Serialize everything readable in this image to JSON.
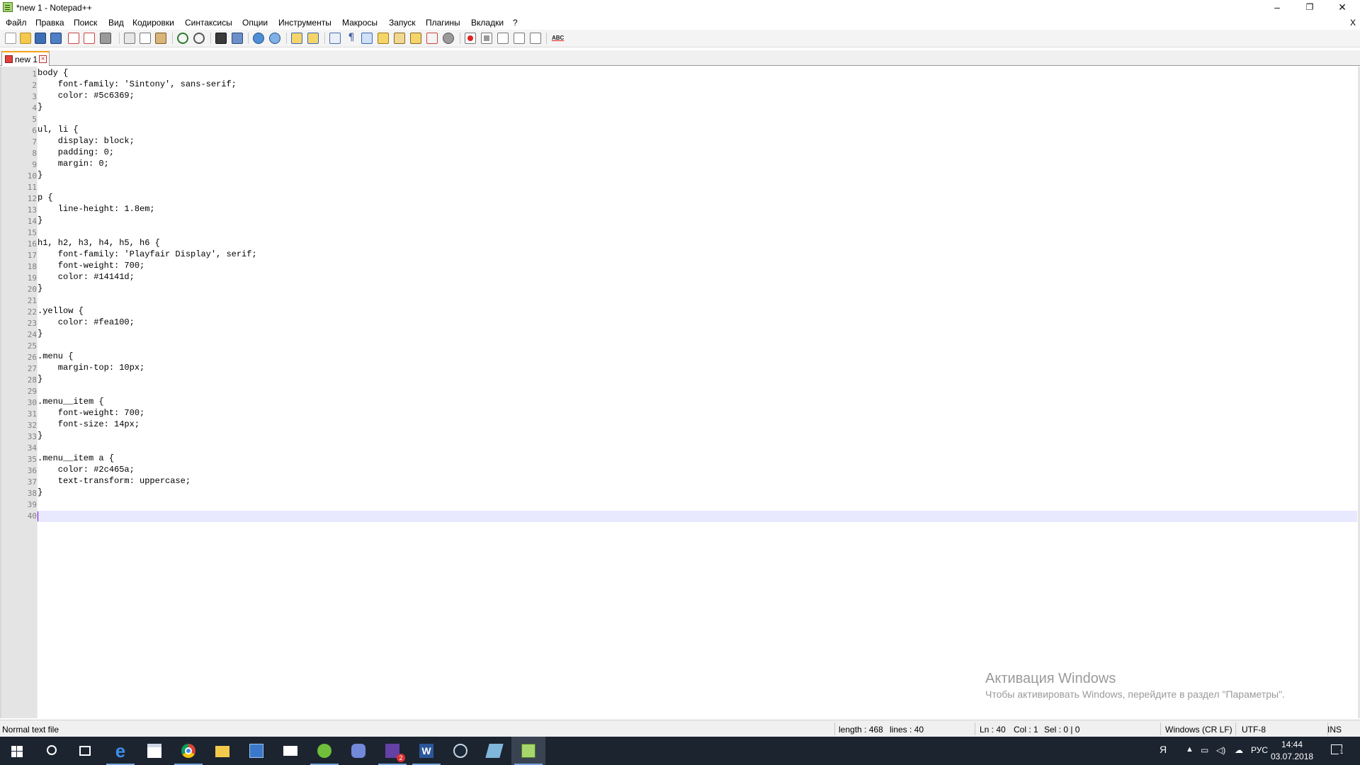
{
  "window": {
    "title": "*new 1 - Notepad++",
    "minimize": "–",
    "restore": "❐",
    "close": "✕"
  },
  "menu": {
    "items": [
      "Файл",
      "Правка",
      "Поиск",
      "Вид",
      "Кодировки",
      "Синтаксисы",
      "Опции",
      "Инструменты",
      "Макросы",
      "Запуск",
      "Плагины",
      "Вкладки",
      "?"
    ],
    "close_doc": "X"
  },
  "toolbar": {
    "icons": [
      "new-file-icon",
      "open-file-icon",
      "save-icon",
      "save-all-icon",
      "close-icon",
      "close-all-icon",
      "print-icon",
      "cut-icon",
      "copy-icon",
      "paste-icon",
      "undo-icon",
      "redo-icon",
      "find-icon",
      "replace-icon",
      "zoom-in-icon",
      "zoom-out-icon",
      "sync-vertical-icon",
      "sync-horizontal-icon",
      "word-wrap-icon",
      "show-all-chars-icon",
      "indent-guide-icon",
      "document-map-icon",
      "function-list-icon",
      "folder-workspace-icon",
      "monitoring-icon",
      "record-macro-icon",
      "stop-record-icon",
      "play-macro-icon",
      "run-macro-multiple-icon",
      "save-macro-icon",
      "spell-check-icon"
    ],
    "spellcheck_label": "ABC"
  },
  "tab": {
    "label": "new 1",
    "close": "×"
  },
  "editor": {
    "lines": [
      "body {",
      "    font-family: 'Sintony', sans-serif;",
      "    color: #5c6369;",
      "}",
      "",
      "ul, li {",
      "    display: block;",
      "    padding: 0;",
      "    margin: 0;",
      "}",
      "",
      "p {",
      "    line-height: 1.8em;",
      "}",
      "",
      "h1, h2, h3, h4, h5, h6 {",
      "    font-family: 'Playfair Display', serif;",
      "    font-weight: 700;",
      "    color: #14141d;",
      "}",
      "",
      ".yellow {",
      "    color: #fea100;",
      "}",
      "",
      ".menu {",
      "    margin-top: 10px;",
      "}",
      "",
      ".menu__item {",
      "    font-weight: 700;",
      "    font-size: 14px;",
      "}",
      "",
      ".menu__item a {",
      "    color: #2c465a;",
      "    text-transform: uppercase;",
      "}",
      "",
      ""
    ],
    "current_line": 40
  },
  "activation": {
    "title": "Активация Windows",
    "subtitle": "Чтобы активировать Windows, перейдите в раздел \"Параметры\"."
  },
  "status": {
    "file_type": "Normal text file",
    "length": "length : 468",
    "lines": "lines : 40",
    "ln": "Ln : 40",
    "col": "Col : 1",
    "sel": "Sel : 0 | 0",
    "eol": "Windows (CR LF)",
    "encoding": "UTF-8",
    "mode": "INS"
  },
  "taskbar": {
    "apps": [
      "start-icon",
      "search-icon",
      "task-view-icon",
      "edge-icon",
      "store-icon",
      "chrome-icon",
      "file-explorer-icon",
      "calculator-icon",
      "mail-icon",
      "utorrent-icon",
      "discord-icon",
      "twitch-icon",
      "word-icon",
      "steam-icon",
      "book-icon",
      "notepadpp-icon"
    ],
    "twitch_badge": "2",
    "lang": "РУС",
    "time": "14:44",
    "date": "03.07.2018",
    "notification_count": "1"
  },
  "colors": {
    "accent_tab": "#f7a21b",
    "current_line": "#e8e8ff",
    "caret": "#8000ff",
    "taskbar": "#1c2430"
  }
}
